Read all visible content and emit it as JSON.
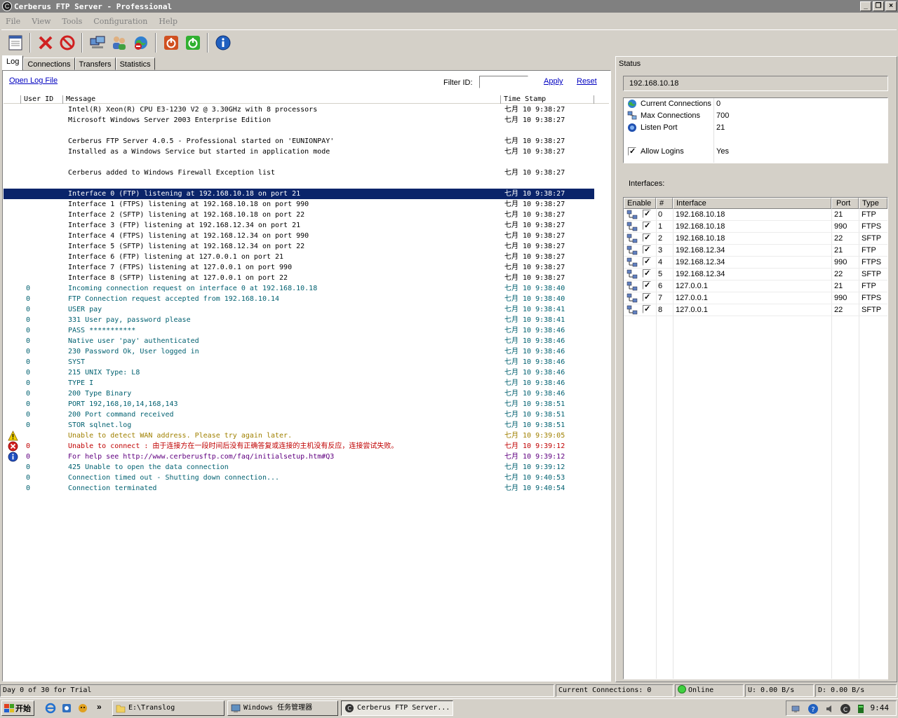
{
  "window": {
    "title": "Cerberus FTP Server - Professional"
  },
  "menu": [
    "File",
    "View",
    "Tools",
    "Configuration",
    "Help"
  ],
  "toolbar_icons": [
    "notepad-icon",
    "delete-icon",
    "stop-icon",
    "computers-icon",
    "users-icon",
    "globe-block-icon",
    "power-off-icon",
    "power-on-icon",
    "info-icon"
  ],
  "tabs": [
    "Log",
    "Connections",
    "Transfers",
    "Statistics"
  ],
  "log_controls": {
    "open_log": "Open Log File",
    "filter_label": "Filter ID:",
    "filter_value": "",
    "apply": "Apply",
    "reset": "Reset"
  },
  "log_columns": {
    "user_id": "User ID",
    "message": "Message",
    "time_stamp": "Time Stamp"
  },
  "log_rows": [
    {
      "row": 0,
      "level": "info",
      "uid": "",
      "msg": "Intel(R) Xeon(R) CPU E3-1230 V2 @ 3.30GHz with 8 processors",
      "ts": "七月 10 9:38:27"
    },
    {
      "row": 1,
      "level": "info",
      "uid": "",
      "msg": "Microsoft Windows Server 2003 Enterprise Edition",
      "ts": "七月 10 9:38:27"
    },
    {
      "row": 3,
      "level": "info",
      "uid": "",
      "msg": "Cerberus FTP Server 4.0.5 - Professional started on 'EUNIONPAY'",
      "ts": "七月 10 9:38:27"
    },
    {
      "row": 4,
      "level": "info",
      "uid": "",
      "msg": "Installed as a Windows Service but started in application mode",
      "ts": "七月 10 9:38:27"
    },
    {
      "row": 6,
      "level": "info",
      "uid": "",
      "msg": "Cerberus added to Windows Firewall Exception list",
      "ts": "七月 10 9:38:27"
    },
    {
      "row": 8,
      "level": "info",
      "uid": "",
      "msg": "Interface 0 (FTP) listening at 192.168.10.18 on port 21",
      "ts": "七月 10 9:38:27",
      "selected": true
    },
    {
      "row": 9,
      "level": "info",
      "uid": "",
      "msg": "Interface 1 (FTPS) listening at 192.168.10.18 on port 990",
      "ts": "七月 10 9:38:27"
    },
    {
      "row": 10,
      "level": "info",
      "uid": "",
      "msg": "Interface 2 (SFTP) listening at 192.168.10.18 on port 22",
      "ts": "七月 10 9:38:27"
    },
    {
      "row": 11,
      "level": "info",
      "uid": "",
      "msg": "Interface 3 (FTP) listening at 192.168.12.34 on port 21",
      "ts": "七月 10 9:38:27"
    },
    {
      "row": 12,
      "level": "info",
      "uid": "",
      "msg": "Interface 4 (FTPS) listening at 192.168.12.34 on port 990",
      "ts": "七月 10 9:38:27"
    },
    {
      "row": 13,
      "level": "info",
      "uid": "",
      "msg": "Interface 5 (SFTP) listening at 192.168.12.34 on port 22",
      "ts": "七月 10 9:38:27"
    },
    {
      "row": 14,
      "level": "info",
      "uid": "",
      "msg": "Interface 6 (FTP) listening at 127.0.0.1 on port 21",
      "ts": "七月 10 9:38:27"
    },
    {
      "row": 15,
      "level": "info",
      "uid": "",
      "msg": "Interface 7 (FTPS) listening at 127.0.0.1 on port 990",
      "ts": "七月 10 9:38:27"
    },
    {
      "row": 16,
      "level": "info",
      "uid": "",
      "msg": "Interface 8 (SFTP) listening at 127.0.0.1 on port 22",
      "ts": "七月 10 9:38:27"
    },
    {
      "row": 17,
      "level": "conn",
      "uid": "0",
      "msg": "Incoming connection request on interface 0 at 192.168.10.18",
      "ts": "七月 10 9:38:40"
    },
    {
      "row": 18,
      "level": "conn",
      "uid": "0",
      "msg": "FTP Connection request accepted from 192.168.10.14",
      "ts": "七月 10 9:38:40"
    },
    {
      "row": 19,
      "level": "conn",
      "uid": "0",
      "msg": "USER pay",
      "ts": "七月 10 9:38:41"
    },
    {
      "row": 20,
      "level": "conn",
      "uid": "0",
      "msg": "331 User pay, password please",
      "ts": "七月 10 9:38:41"
    },
    {
      "row": 21,
      "level": "conn",
      "uid": "0",
      "msg": "PASS ***********",
      "ts": "七月 10 9:38:46"
    },
    {
      "row": 22,
      "level": "conn",
      "uid": "0",
      "msg": "Native user 'pay' authenticated",
      "ts": "七月 10 9:38:46"
    },
    {
      "row": 23,
      "level": "conn",
      "uid": "0",
      "msg": "230 Password Ok, User logged in",
      "ts": "七月 10 9:38:46"
    },
    {
      "row": 24,
      "level": "conn",
      "uid": "0",
      "msg": "SYST",
      "ts": "七月 10 9:38:46"
    },
    {
      "row": 25,
      "level": "conn",
      "uid": "0",
      "msg": "215 UNIX Type: L8",
      "ts": "七月 10 9:38:46"
    },
    {
      "row": 26,
      "level": "conn",
      "uid": "0",
      "msg": "TYPE I",
      "ts": "七月 10 9:38:46"
    },
    {
      "row": 27,
      "level": "conn",
      "uid": "0",
      "msg": "200 Type Binary",
      "ts": "七月 10 9:38:46"
    },
    {
      "row": 28,
      "level": "conn",
      "uid": "0",
      "msg": "PORT 192,168,10,14,168,143",
      "ts": "七月 10 9:38:51"
    },
    {
      "row": 29,
      "level": "conn",
      "uid": "0",
      "msg": "200 Port command received",
      "ts": "七月 10 9:38:51"
    },
    {
      "row": 30,
      "level": "conn",
      "uid": "0",
      "msg": "STOR sqlnet.log",
      "ts": "七月 10 9:38:51"
    },
    {
      "row": 31,
      "level": "warn",
      "uid": "",
      "msg": "Unable to detect WAN address. Please try again later.",
      "ts": "七月 10 9:39:05",
      "icon": "warning-icon"
    },
    {
      "row": 32,
      "level": "err",
      "uid": "0",
      "msg": "Unable to connect : 由于连接方在一段时间后没有正确答复或连接的主机没有反应，连接尝试失败。",
      "ts": "七月 10 9:39:12",
      "icon": "error-icon"
    },
    {
      "row": 33,
      "level": "help",
      "uid": "0",
      "msg": "For help see http://www.cerberusftp.com/faq/initialsetup.htm#Q3",
      "ts": "七月 10 9:39:12",
      "icon": "info-icon"
    },
    {
      "row": 34,
      "level": "conn",
      "uid": "0",
      "msg": "425 Unable to open the data connection",
      "ts": "七月 10 9:39:12"
    },
    {
      "row": 35,
      "level": "conn",
      "uid": "0",
      "msg": "Connection timed out - Shutting down connection...",
      "ts": "七月 10 9:40:53"
    },
    {
      "row": 36,
      "level": "conn",
      "uid": "0",
      "msg": "Connection terminated",
      "ts": "七月 10 9:40:54"
    }
  ],
  "status": {
    "title": "Status",
    "ip": "192.168.10.18",
    "props": [
      {
        "name": "Current Connections",
        "value": "0",
        "icon": "globe-icon"
      },
      {
        "name": "Max Connections",
        "value": "700",
        "icon": "network-icon"
      },
      {
        "name": "Listen Port",
        "value": "21",
        "icon": "port-icon"
      },
      {
        "name": "Allow Logins",
        "value": "Yes",
        "icon": "checkbox-icon",
        "checked": true
      }
    ],
    "interfaces_label": "Interfaces:",
    "iface_columns": [
      "Enable",
      "#",
      "Interface",
      "Port",
      "Type"
    ],
    "interfaces": [
      {
        "num": "0",
        "ip": "192.168.10.18",
        "port": "21",
        "type": "FTP",
        "enabled": true
      },
      {
        "num": "1",
        "ip": "192.168.10.18",
        "port": "990",
        "type": "FTPS",
        "enabled": true
      },
      {
        "num": "2",
        "ip": "192.168.10.18",
        "port": "22",
        "type": "SFTP",
        "enabled": true
      },
      {
        "num": "3",
        "ip": "192.168.12.34",
        "port": "21",
        "type": "FTP",
        "enabled": true
      },
      {
        "num": "4",
        "ip": "192.168.12.34",
        "port": "990",
        "type": "FTPS",
        "enabled": true
      },
      {
        "num": "5",
        "ip": "192.168.12.34",
        "port": "22",
        "type": "SFTP",
        "enabled": true
      },
      {
        "num": "6",
        "ip": "127.0.0.1",
        "port": "21",
        "type": "FTP",
        "enabled": true
      },
      {
        "num": "7",
        "ip": "127.0.0.1",
        "port": "990",
        "type": "FTPS",
        "enabled": true
      },
      {
        "num": "8",
        "ip": "127.0.0.1",
        "port": "22",
        "type": "SFTP",
        "enabled": true
      }
    ]
  },
  "statusbar": {
    "trial": "Day 0 of 30 for Trial",
    "connections": "Current Connections: 0",
    "online": "Online",
    "upload": "U: 0.00 B/s",
    "download": "D: 0.00 B/s"
  },
  "taskbar": {
    "start": "开始",
    "tasks": [
      {
        "label": "E:\\Translog",
        "icon": "folder-icon"
      },
      {
        "label": "Windows 任务管理器",
        "icon": "taskmgr-icon"
      },
      {
        "label": "Cerberus FTP Server...",
        "icon": "cerberus-icon",
        "active": true
      }
    ],
    "clock": "9:44"
  }
}
